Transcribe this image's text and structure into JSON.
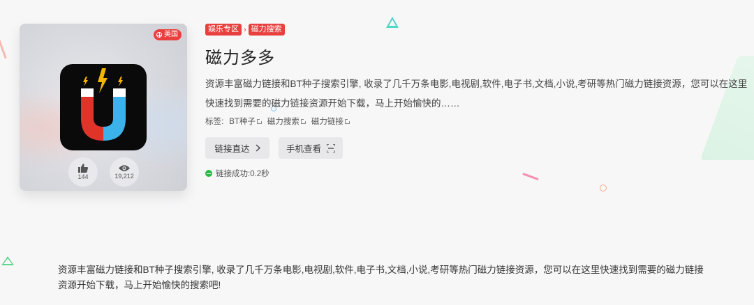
{
  "card": {
    "region": "美国",
    "likes": "144",
    "views": "19,212"
  },
  "breadcrumb": {
    "category": "娱乐专区",
    "subcategory": "磁力搜索"
  },
  "title": "磁力多多",
  "description": "资源丰富磁力链接和BT种子搜索引擎, 收录了几千万条电影,电视剧,软件,电子书,文档,小说,考研等热门磁力链接资源，您可以在这里快速找到需要的磁力链接资源开始下载，马上开始愉快的……",
  "tags": {
    "label": "标签:",
    "items": [
      "BT种子",
      "磁力搜索",
      "磁力链接"
    ]
  },
  "buttons": {
    "direct": "链接直达",
    "mobile": "手机查看"
  },
  "status": "链接成功:0.2秒",
  "footer_description": "资源丰富磁力链接和BT种子搜索引擎, 收录了几千万条电影,电视剧,软件,电子书,文档,小说,考研等热门磁力链接资源，您可以在这里快速找到需要的磁力链接资源开始下载，马上开始愉快的搜索吧!",
  "colors": {
    "accent_red": "#e8403e",
    "success_green": "#2fb845",
    "magnet_red": "#e0342a",
    "magnet_blue": "#3bb3ea",
    "bolt_yellow": "#f5b400"
  }
}
